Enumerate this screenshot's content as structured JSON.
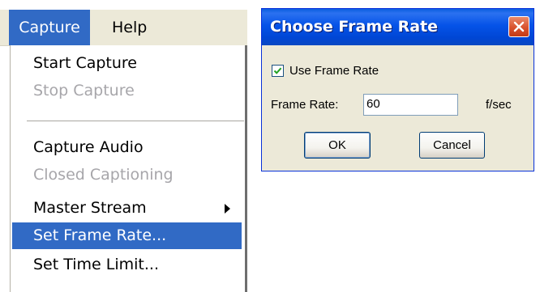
{
  "menubar": {
    "items": [
      {
        "label": "Capture"
      },
      {
        "label": "Help"
      }
    ]
  },
  "capture_menu": {
    "items": [
      {
        "label": "Start Capture",
        "enabled": true
      },
      {
        "label": "Stop Capture",
        "enabled": false
      },
      {
        "label": "Capture Audio",
        "enabled": true
      },
      {
        "label": "Closed Captioning",
        "enabled": false
      },
      {
        "label": "Master Stream",
        "enabled": true,
        "submenu": true
      },
      {
        "label": "Set Frame Rate...",
        "enabled": true,
        "highlighted": true
      },
      {
        "label": "Set Time Limit...",
        "enabled": true
      }
    ]
  },
  "dialog": {
    "title": "Choose Frame Rate",
    "use_frame_rate_label": "Use Frame Rate",
    "use_frame_rate_checked": true,
    "frame_rate_label": "Frame Rate:",
    "frame_rate_value": "60",
    "unit": "f/sec",
    "ok_label": "OK",
    "cancel_label": "Cancel"
  },
  "colors": {
    "highlight": "#316ac5",
    "titlebar": "#0a5fe0",
    "dialog_bg": "#ece9d8",
    "disabled_text": "#a7a6aa",
    "close_button": "#d9522d"
  },
  "icons": {
    "submenu": "chevron-right-icon",
    "close": "close-icon",
    "checkbox": "checkmark-icon"
  }
}
